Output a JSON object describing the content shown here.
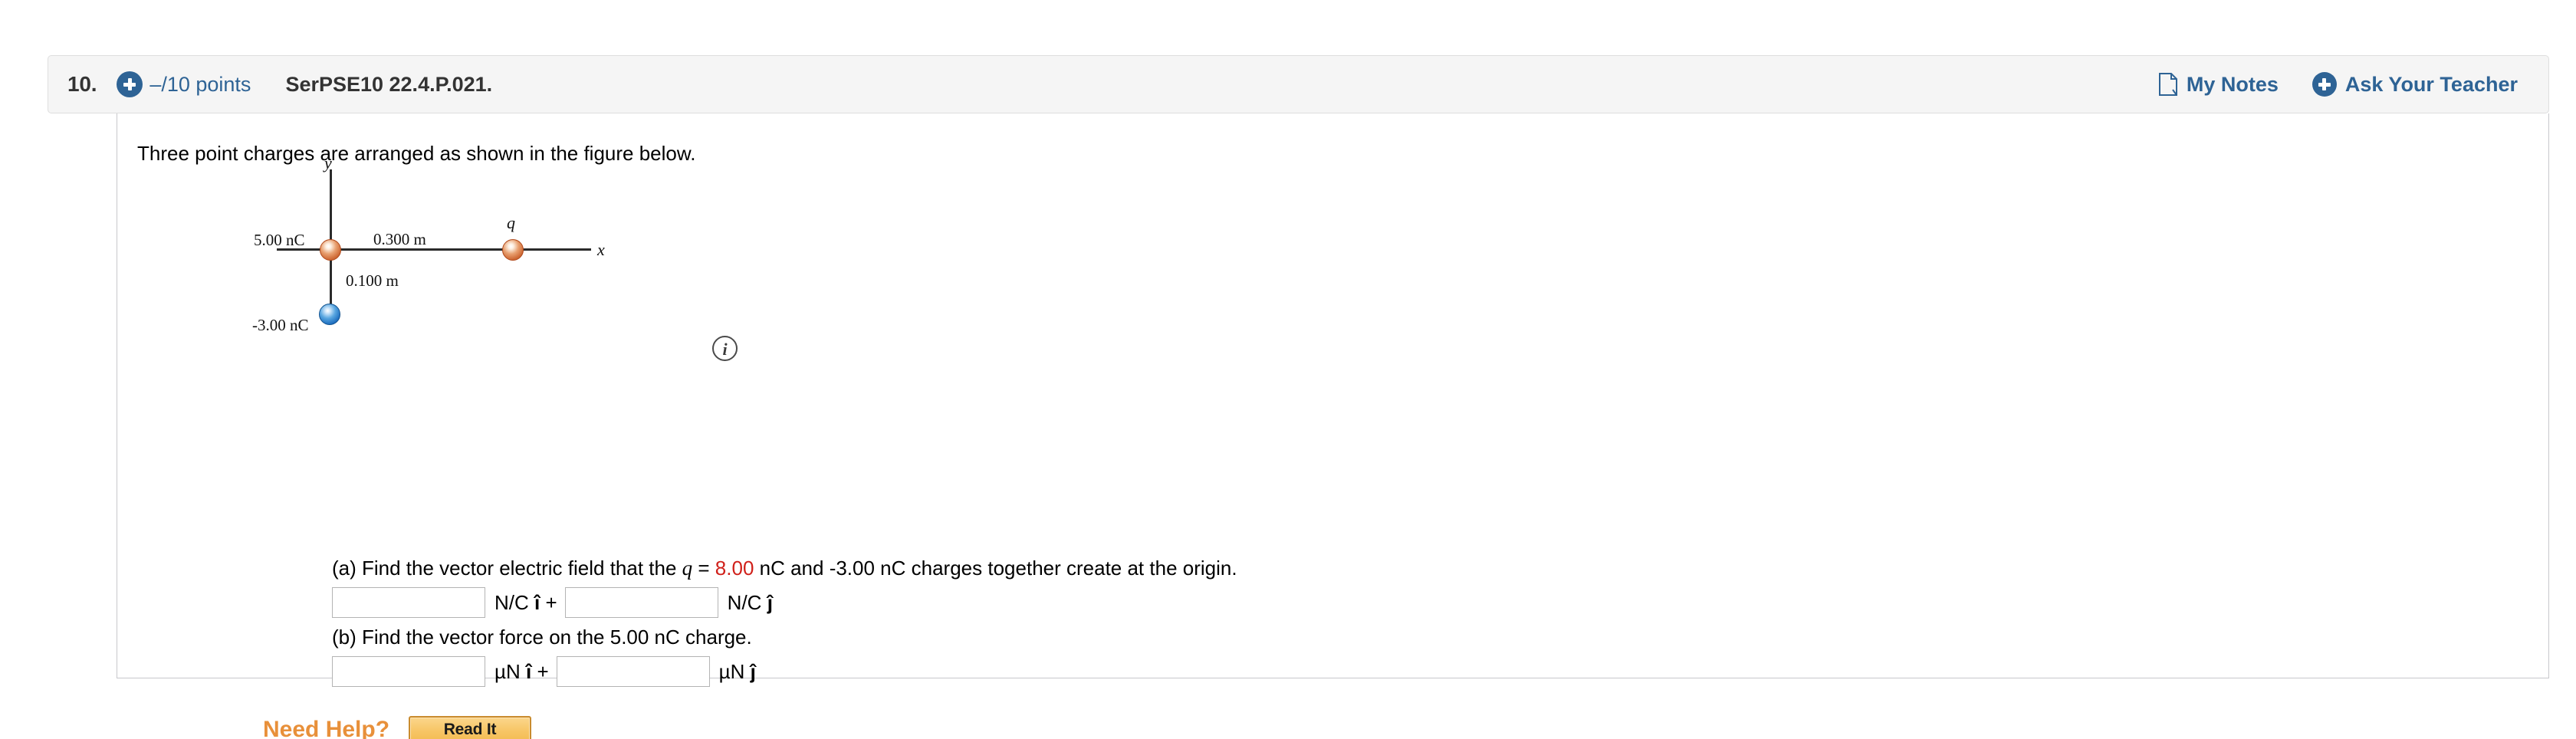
{
  "header": {
    "question_number": "10.",
    "points": "–/10 points",
    "question_code": "SerPSE10 22.4.P.021.",
    "plus_icon": "plus-circle-icon",
    "my_notes_label": "My Notes",
    "my_notes_icon": "note-page-icon",
    "ask_teacher_label": "Ask Your Teacher",
    "ask_teacher_icon": "plus-circle-icon",
    "accent_blue": "#2e6395",
    "background": "#f5f5f5"
  },
  "body": {
    "intro_text": "Three point charges are arranged as shown in the figure below."
  },
  "figure": {
    "name": "three-point-charges-diagram",
    "y_axis_label": "y",
    "x_axis_label": "x",
    "q_label": "q",
    "charge_left_label": "5.00 nC",
    "charge_bottom_label": "-3.00 nC",
    "distance_horizontal": "0.300 m",
    "distance_vertical": "0.100 m",
    "info_icon_glyph": "i",
    "positive_charge_color": "#cf6a36",
    "negative_charge_color": "#1f6fc0"
  },
  "parts": [
    {
      "id": "a",
      "prompt_before": "(a) Find the vector electric field that the ",
      "var_symbol": "q",
      "equals": " = ",
      "highlight_value": "8.00",
      "prompt_after": " nC and -3.00 nC charges together create at the origin.",
      "input_i_value": "",
      "input_j_value": "",
      "unit_i": "N/C",
      "unit_i_hat": "î",
      "plus": "+",
      "unit_j": "N/C",
      "unit_j_hat": "ĵ",
      "highlight_color": "#d0201a"
    },
    {
      "id": "b",
      "prompt": "(b) Find the vector force on the 5.00 nC charge.",
      "input_i_value": "",
      "input_j_value": "",
      "unit_i": "µN",
      "unit_i_hat": "î",
      "plus": "+",
      "unit_j": "µN",
      "unit_j_hat": "ĵ"
    }
  ],
  "need_help": {
    "label": "Need Help?",
    "button_label": "Read It",
    "label_color": "#e8903a",
    "button_color": "#f7c565"
  }
}
